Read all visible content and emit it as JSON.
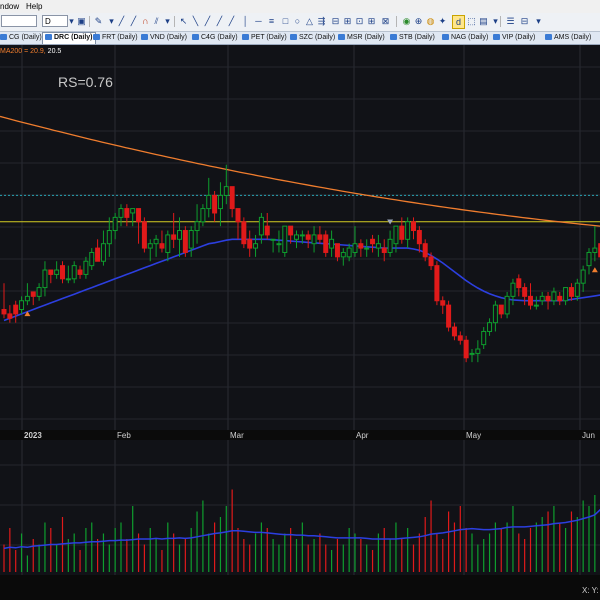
{
  "menu": {
    "window": "ndow",
    "help": "Help"
  },
  "toolbar": {
    "symbol": "",
    "period": "D",
    "buttons": [
      "zoom-in",
      "cursor",
      "pencil",
      "trendline",
      "horizontal-line",
      "rectangle",
      "ellipse",
      "text",
      "fibonacci",
      "measure",
      "refresh",
      "indicator",
      "draw-mode",
      "layout"
    ]
  },
  "tabs": [
    "CG (Daily)",
    "DRC (Daily)",
    "FRT (Daily)",
    "VND (Daily)",
    "C4G (Daily)",
    "PET (Daily)",
    "SZC (Daily)",
    "MSR (Daily)",
    "STB (Daily)",
    "NAG (Daily)",
    "VIP (Daily)",
    "AMS (Daily)"
  ],
  "active_tab": "DRC (Daily)",
  "indicator_legend": {
    "ma200": "MA200 = 20.9,",
    "ma50": "20.5"
  },
  "rs_label": "RS=0.76",
  "status_text": "X: Y:",
  "colors": {
    "up": "#0e9e2e",
    "down": "#e01a1a",
    "ma200": "#f07d2e",
    "ma50": "#2c3fe0",
    "hline": "#d4cc22",
    "dotted": "#2aa5b5"
  },
  "chart_data": {
    "type": "candlestick",
    "x_ticks": [
      "2023",
      "Feb",
      "Mar",
      "Apr",
      "May",
      "Jun"
    ],
    "candles": [
      [
        19.7,
        19.6,
        20.3,
        19.5
      ],
      [
        19.6,
        19.5,
        19.8,
        19.4
      ],
      [
        19.8,
        19.6,
        19.9,
        19.4
      ],
      [
        19.7,
        19.9,
        20.0,
        19.6
      ],
      [
        19.9,
        20.0,
        20.3,
        19.8
      ],
      [
        20.1,
        20.0,
        20.1,
        19.8
      ],
      [
        20.0,
        20.2,
        20.3,
        19.9
      ],
      [
        20.2,
        20.6,
        20.8,
        20.0
      ],
      [
        20.6,
        20.5,
        20.6,
        20.3
      ],
      [
        20.5,
        20.6,
        20.8,
        20.4
      ],
      [
        20.7,
        20.4,
        20.8,
        20.3
      ],
      [
        20.4,
        20.4,
        20.7,
        20.3
      ],
      [
        20.4,
        20.7,
        20.8,
        20.3
      ],
      [
        20.6,
        20.5,
        20.7,
        20.4
      ],
      [
        20.5,
        20.8,
        20.9,
        20.4
      ],
      [
        20.7,
        21.0,
        21.1,
        20.6
      ],
      [
        21.1,
        20.8,
        21.3,
        20.8
      ],
      [
        20.8,
        21.2,
        21.5,
        20.7
      ],
      [
        21.2,
        21.5,
        21.8,
        20.9
      ],
      [
        21.5,
        21.8,
        21.9,
        21.3
      ],
      [
        21.8,
        22.0,
        22.1,
        21.6
      ],
      [
        22.0,
        21.8,
        22.1,
        21.6
      ],
      [
        21.9,
        22.0,
        22.0,
        21.6
      ],
      [
        22.0,
        21.7,
        22.0,
        21.2
      ],
      [
        21.7,
        21.1,
        21.8,
        21.0
      ],
      [
        21.1,
        21.2,
        21.3,
        20.8
      ],
      [
        21.2,
        21.3,
        21.4,
        20.9
      ],
      [
        21.2,
        21.1,
        21.5,
        21.0
      ],
      [
        21.0,
        21.4,
        21.5,
        20.8
      ],
      [
        21.4,
        21.3,
        21.9,
        21.1
      ],
      [
        21.3,
        21.5,
        21.8,
        20.9
      ],
      [
        21.5,
        21.0,
        21.6,
        20.9
      ],
      [
        21.1,
        21.5,
        21.6,
        20.9
      ],
      [
        21.5,
        21.7,
        22.1,
        21.2
      ],
      [
        21.7,
        22.0,
        22.1,
        21.6
      ],
      [
        22.0,
        22.3,
        22.7,
        21.8
      ],
      [
        22.3,
        21.9,
        22.4,
        21.7
      ],
      [
        22.0,
        22.3,
        22.6,
        21.6
      ],
      [
        22.3,
        22.5,
        23.0,
        22.1
      ],
      [
        22.5,
        22.0,
        22.5,
        21.8
      ],
      [
        22.0,
        21.7,
        22.0,
        21.3
      ],
      [
        21.7,
        21.2,
        21.8,
        21.1
      ],
      [
        21.3,
        21.1,
        21.5,
        20.9
      ],
      [
        21.1,
        21.2,
        21.4,
        20.9
      ],
      [
        21.4,
        21.8,
        21.9,
        21.2
      ],
      [
        21.6,
        21.4,
        21.9,
        21.3
      ],
      [
        21.3,
        21.3,
        21.3,
        21.0
      ],
      [
        21.2,
        21.2,
        21.5,
        21.0
      ],
      [
        21.0,
        21.6,
        21.6,
        20.9
      ],
      [
        21.6,
        21.4,
        21.6,
        21.2
      ],
      [
        21.3,
        21.4,
        21.5,
        21.1
      ],
      [
        21.4,
        21.4,
        21.5,
        21.2
      ],
      [
        21.4,
        21.3,
        21.5,
        21.1
      ],
      [
        21.2,
        21.4,
        21.6,
        21.0
      ],
      [
        21.4,
        21.3,
        21.6,
        21.2
      ],
      [
        21.4,
        21.0,
        21.5,
        20.9
      ],
      [
        21.1,
        21.3,
        21.5,
        20.9
      ],
      [
        21.2,
        20.9,
        21.2,
        20.8
      ],
      [
        20.9,
        21.0,
        21.1,
        20.7
      ],
      [
        20.9,
        21.1,
        21.2,
        20.8
      ],
      [
        21.0,
        21.2,
        21.6,
        20.9
      ],
      [
        21.2,
        21.1,
        21.3,
        20.9
      ],
      [
        21.1,
        21.1,
        21.3,
        20.9
      ],
      [
        21.3,
        21.2,
        21.4,
        21.0
      ],
      [
        21.1,
        21.2,
        21.4,
        20.9
      ],
      [
        21.1,
        21.0,
        21.3,
        20.8
      ],
      [
        21.0,
        21.3,
        21.5,
        20.9
      ],
      [
        21.2,
        21.6,
        21.6,
        21.0
      ],
      [
        21.6,
        21.3,
        21.8,
        21.2
      ],
      [
        21.3,
        21.7,
        21.8,
        21.1
      ],
      [
        21.7,
        21.5,
        21.8,
        21.3
      ],
      [
        21.5,
        21.2,
        21.6,
        21.0
      ],
      [
        21.2,
        20.9,
        21.3,
        20.8
      ],
      [
        20.9,
        20.7,
        21.0,
        20.6
      ],
      [
        20.7,
        19.9,
        20.8,
        19.8
      ],
      [
        19.9,
        19.8,
        20.0,
        19.6
      ],
      [
        19.8,
        19.3,
        19.9,
        19.2
      ],
      [
        19.3,
        19.1,
        19.4,
        19.0
      ],
      [
        19.1,
        19.0,
        19.2,
        18.9
      ],
      [
        19.0,
        18.6,
        19.1,
        18.5
      ],
      [
        18.7,
        18.7,
        18.8,
        18.5
      ],
      [
        18.7,
        18.8,
        19.0,
        18.5
      ],
      [
        18.9,
        19.2,
        19.3,
        18.8
      ],
      [
        19.2,
        19.4,
        19.5,
        19.1
      ],
      [
        19.4,
        19.8,
        19.9,
        19.2
      ],
      [
        19.8,
        19.6,
        19.8,
        19.5
      ],
      [
        19.6,
        20.0,
        20.1,
        19.5
      ],
      [
        20.0,
        20.3,
        20.4,
        19.8
      ],
      [
        20.4,
        20.2,
        20.5,
        20.0
      ],
      [
        20.2,
        20.0,
        20.3,
        19.8
      ],
      [
        20.0,
        19.8,
        20.3,
        19.7
      ],
      [
        19.8,
        19.8,
        20.0,
        19.7
      ],
      [
        19.9,
        20.0,
        20.1,
        19.8
      ],
      [
        20.0,
        19.9,
        20.1,
        19.7
      ],
      [
        19.9,
        20.1,
        20.2,
        19.8
      ],
      [
        20.0,
        19.9,
        20.1,
        19.8
      ],
      [
        19.9,
        20.2,
        20.2,
        19.8
      ],
      [
        20.2,
        20.0,
        20.3,
        19.9
      ],
      [
        20.0,
        20.3,
        20.4,
        19.9
      ],
      [
        20.3,
        20.6,
        20.7,
        20.1
      ],
      [
        20.7,
        21.0,
        21.1,
        20.5
      ],
      [
        21.0,
        21.1,
        21.6,
        20.8
      ],
      [
        21.2,
        20.9,
        21.5,
        20.6
      ],
      [
        21.0,
        21.4,
        21.5,
        20.5
      ]
    ],
    "volume": [
      5,
      8,
      4,
      7,
      3,
      6,
      5,
      9,
      8,
      5,
      10,
      6,
      7,
      4,
      8,
      9,
      6,
      7,
      5,
      8,
      9,
      6,
      12,
      7,
      5,
      8,
      6,
      4,
      9,
      7,
      5,
      6,
      8,
      11,
      13,
      7,
      9,
      10,
      12,
      15,
      8,
      6,
      5,
      7,
      9,
      8,
      6,
      5,
      7,
      8,
      6,
      9,
      5,
      6,
      7,
      5,
      4,
      6,
      5,
      8,
      7,
      6,
      5,
      4,
      7,
      8,
      6,
      9,
      6,
      8,
      5,
      7,
      10,
      13,
      7,
      6,
      11,
      9,
      12,
      8,
      7,
      5,
      6,
      7,
      9,
      8,
      9,
      12,
      7,
      6,
      8,
      9,
      10,
      11,
      12,
      9,
      8,
      11,
      10,
      13,
      12,
      14,
      22,
      17
    ],
    "volume_ma": [
      4.3,
      4.5,
      4.4,
      4.6,
      4.5,
      4.7,
      4.8,
      4.9,
      5.0,
      5.0,
      5.1,
      5.2,
      5.3,
      5.3,
      5.4,
      5.5,
      5.5,
      5.6,
      5.7,
      5.7,
      5.8,
      5.8,
      5.9,
      6.0,
      6.0,
      6.0,
      6.1,
      6.0,
      6.1,
      6.1,
      6.2,
      6.1,
      6.2,
      6.4,
      6.6,
      6.8,
      7.0,
      7.1,
      7.3,
      7.5,
      7.5,
      7.4,
      7.3,
      7.2,
      7.2,
      7.1,
      7.0,
      6.9,
      6.8,
      6.8,
      6.7,
      6.7,
      6.6,
      6.6,
      6.5,
      6.4,
      6.3,
      6.2,
      6.2,
      6.2,
      6.2,
      6.2,
      6.1,
      6.0,
      6.0,
      6.0,
      6.0,
      6.0,
      6.1,
      6.2,
      6.3,
      6.4,
      6.6,
      6.9,
      7.0,
      7.1,
      7.3,
      7.5,
      7.7,
      7.8,
      7.9,
      7.8,
      7.7,
      7.7,
      7.8,
      7.9,
      8.1,
      8.2,
      8.2,
      8.2,
      8.3,
      8.4,
      8.5,
      8.6,
      8.8,
      8.9,
      9.0,
      9.2,
      9.4,
      9.7,
      10.0,
      10.4,
      11.4,
      12.0
    ],
    "ma200_start": 24.1,
    "ma200_end": 21.6,
    "ma50": [
      19.45,
      19.5,
      19.55,
      19.6,
      19.65,
      19.7,
      19.75,
      19.8,
      19.85,
      19.9,
      19.95,
      20.0,
      20.05,
      20.1,
      20.15,
      20.2,
      20.25,
      20.3,
      20.35,
      20.4,
      20.45,
      20.5,
      20.55,
      20.6,
      20.65,
      20.7,
      20.75,
      20.8,
      20.85,
      20.9,
      20.95,
      21.0,
      21.05,
      21.1,
      21.15,
      21.2,
      21.22,
      21.25,
      21.28,
      21.3,
      21.3,
      21.3,
      21.3,
      21.3,
      21.3,
      21.3,
      21.29,
      21.28,
      21.27,
      21.26,
      21.25,
      21.24,
      21.23,
      21.22,
      21.21,
      21.2,
      21.19,
      21.18,
      21.17,
      21.16,
      21.15,
      21.14,
      21.13,
      21.12,
      21.11,
      21.1,
      21.1,
      21.1,
      21.1,
      21.1,
      21.08,
      21.05,
      21.0,
      20.93,
      20.85,
      20.76,
      20.66,
      20.56,
      20.46,
      20.36,
      20.27,
      20.19,
      20.12,
      20.06,
      20.01,
      19.97,
      19.94,
      19.92,
      19.91,
      19.9,
      19.9,
      19.9,
      19.9,
      19.9,
      19.9,
      19.9,
      19.91,
      19.93,
      19.95,
      19.97,
      19.99,
      20.01,
      20.03,
      20.05
    ],
    "hline_level": 21.7,
    "dotted_level": 22.3,
    "y_range": [
      17.0,
      25.5
    ],
    "arrows_up": [
      4,
      101
    ],
    "arrow_down": 66
  }
}
